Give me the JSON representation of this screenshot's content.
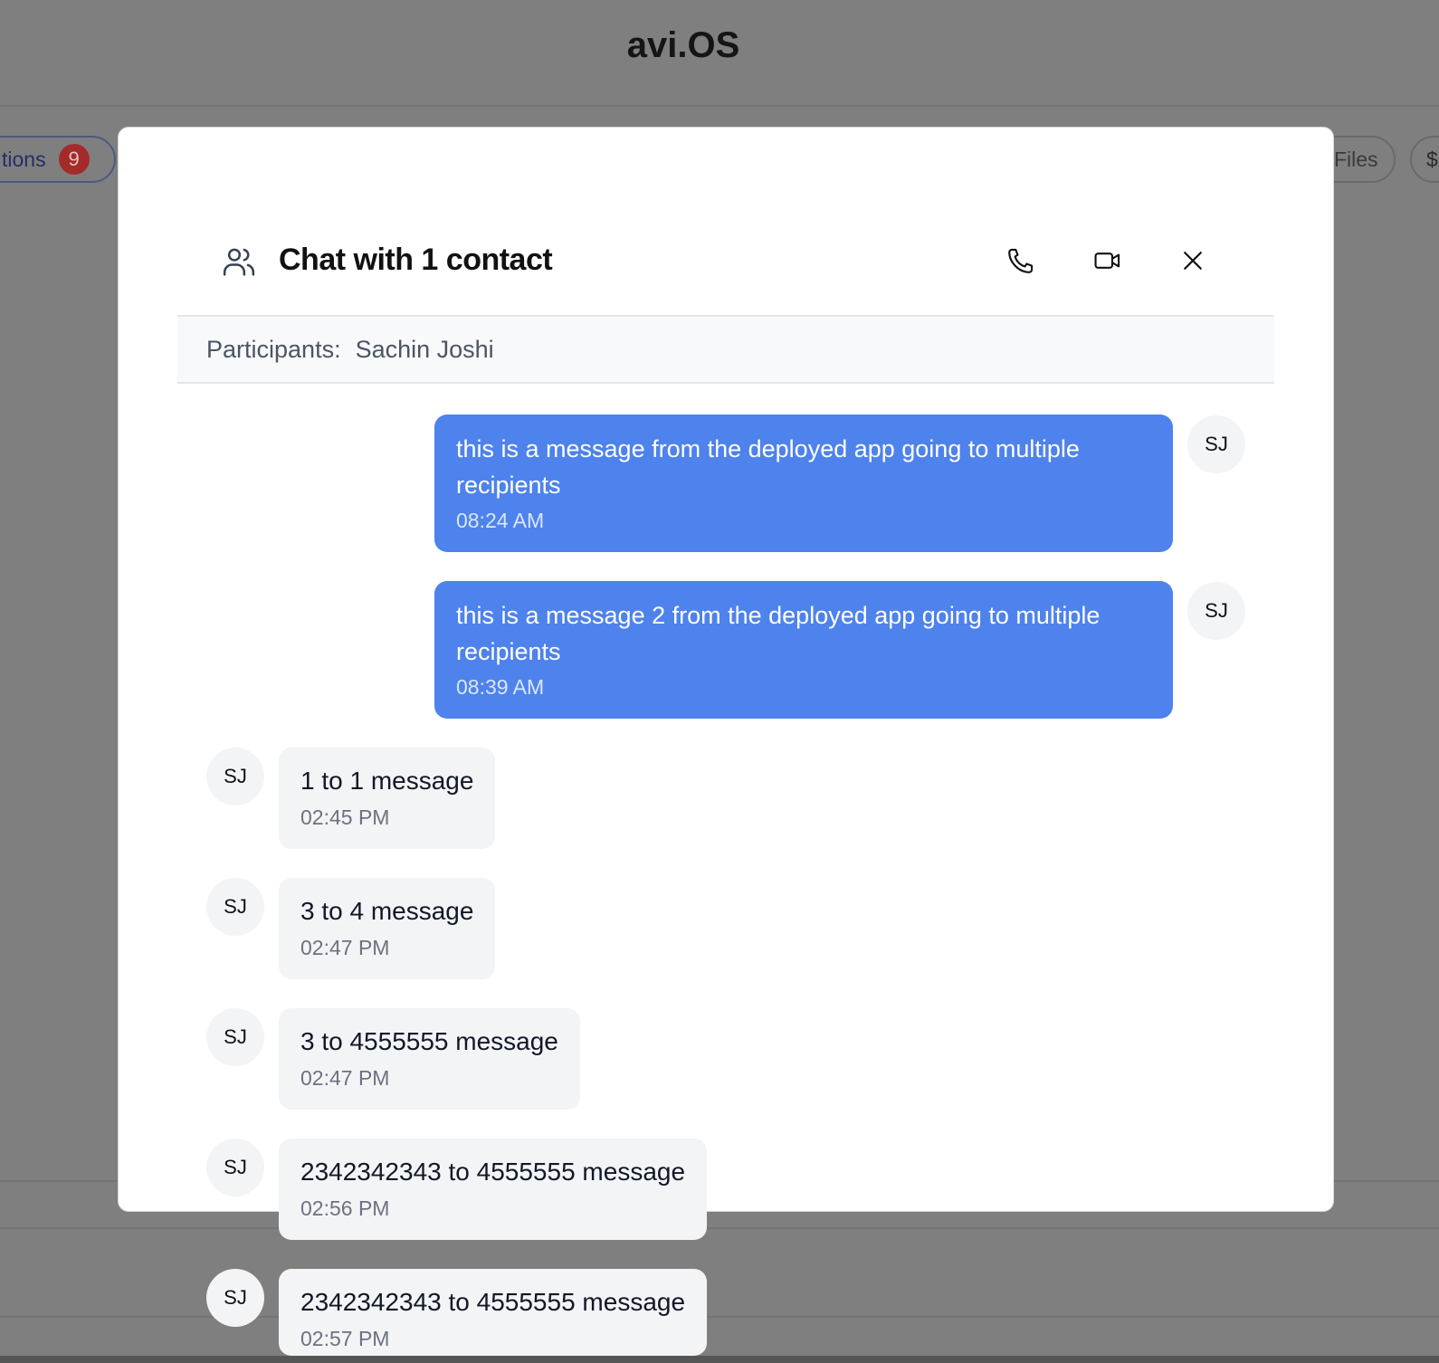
{
  "app": {
    "title": "avi.OS"
  },
  "background": {
    "left_pill_label": "tions",
    "left_pill_badge": "9",
    "files_label": "Files",
    "extra_label": "$"
  },
  "chat": {
    "title": "Chat with 1 contact",
    "participants_label": "Participants:",
    "participants": "Sachin Joshi",
    "icons": [
      "users-icon",
      "phone-icon",
      "video-icon",
      "close-icon"
    ]
  },
  "messages": [
    {
      "direction": "outgoing",
      "avatar": "SJ",
      "text": "this is a message from the deployed app going to multiple recipients",
      "time": "08:24 AM"
    },
    {
      "direction": "outgoing",
      "avatar": "SJ",
      "text": "this is a message 2 from the deployed app going to multiple recipients",
      "time": "08:39 AM"
    },
    {
      "direction": "incoming",
      "avatar": "SJ",
      "text": "1 to 1 message",
      "time": "02:45 PM"
    },
    {
      "direction": "incoming",
      "avatar": "SJ",
      "text": "3 to 4 message",
      "time": "02:47 PM"
    },
    {
      "direction": "incoming",
      "avatar": "SJ",
      "text": "3 to 4555555 message",
      "time": "02:47 PM"
    },
    {
      "direction": "incoming",
      "avatar": "SJ",
      "text": "2342342343 to 4555555 message",
      "time": "02:56 PM"
    },
    {
      "direction": "incoming",
      "avatar": "SJ",
      "text": "2342342343 to 4555555 message",
      "time": "02:57 PM"
    }
  ],
  "colors": {
    "outgoing_bubble": "#4e82ec",
    "incoming_bubble": "#f3f4f6",
    "badge": "#a52a2a",
    "overlay": "#7f7f7f"
  }
}
